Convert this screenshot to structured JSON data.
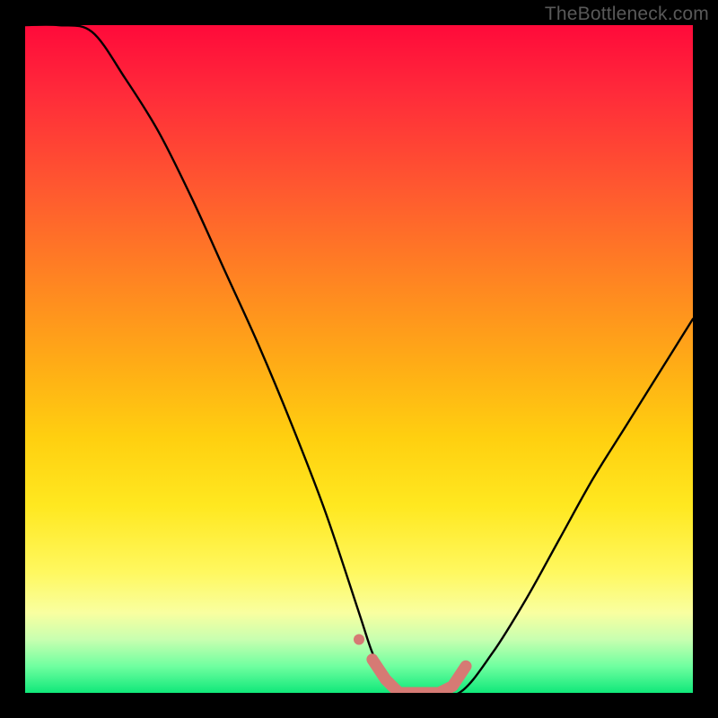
{
  "watermark": "TheBottleneck.com",
  "colors": {
    "background_frame": "#000000",
    "gradient_top": "#ff0a3a",
    "gradient_bottom": "#10e87a",
    "curve_stroke": "#000000",
    "marker_fill": "#d67a74"
  },
  "chart_data": {
    "type": "line",
    "title": "",
    "xlabel": "",
    "ylabel": "",
    "xlim": [
      0,
      100
    ],
    "ylim": [
      0,
      100
    ],
    "x": [
      0,
      5,
      10,
      15,
      20,
      25,
      30,
      35,
      40,
      45,
      50,
      52,
      54,
      56,
      58,
      60,
      65,
      70,
      75,
      80,
      85,
      90,
      95,
      100
    ],
    "series": [
      {
        "name": "bottleneck-curve",
        "values": [
          100,
          100,
          99,
          92,
          84,
          74,
          63,
          52,
          40,
          27,
          12,
          6,
          2,
          0,
          0,
          0,
          0,
          6,
          14,
          23,
          32,
          40,
          48,
          56
        ]
      }
    ],
    "markers": {
      "name": "highlight-segment",
      "x": [
        52,
        54,
        56,
        58,
        60,
        62,
        64,
        66
      ],
      "y": [
        5,
        2,
        0,
        0,
        0,
        0,
        1,
        4
      ]
    }
  }
}
